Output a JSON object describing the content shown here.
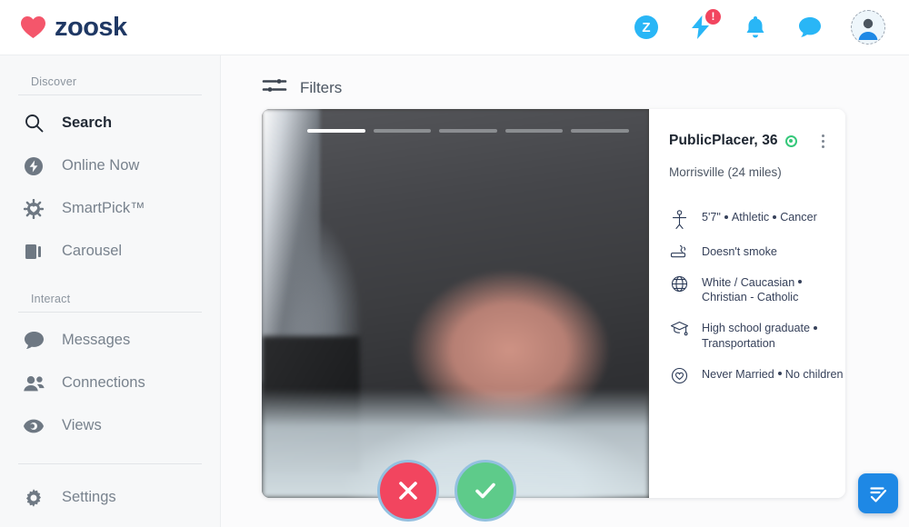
{
  "brand": {
    "name": "zoosk",
    "heart_color": "#f4566b",
    "text_color": "#1f3864"
  },
  "header": {
    "coin_label": "Z",
    "boost_badge": "!",
    "icons": [
      "zoosk-coin-icon",
      "boost-icon",
      "bell-icon",
      "chat-icon",
      "profile-avatar"
    ]
  },
  "sidebar": {
    "sections": [
      {
        "label": "Discover",
        "items": [
          {
            "label": "Search",
            "icon": "search-icon",
            "active": true
          },
          {
            "label": "Online Now",
            "icon": "online-now-icon",
            "active": false
          },
          {
            "label": "SmartPick™",
            "icon": "smartpick-icon",
            "active": false
          },
          {
            "label": "Carousel",
            "icon": "carousel-icon",
            "active": false
          }
        ]
      },
      {
        "label": "Interact",
        "items": [
          {
            "label": "Messages",
            "icon": "messages-icon",
            "active": false
          },
          {
            "label": "Connections",
            "icon": "connections-icon",
            "active": false
          },
          {
            "label": "Views",
            "icon": "views-icon",
            "active": false
          }
        ]
      }
    ],
    "settings": {
      "label": "Settings",
      "icon": "gear-icon"
    }
  },
  "main": {
    "filters_label": "Filters",
    "next_label": "›"
  },
  "profile": {
    "name_age": "PublicPlacer, 36",
    "online": true,
    "location": "Morrisville (24 miles)",
    "photo_count": 5,
    "active_photo": 1,
    "attributes": [
      {
        "icon": "body-icon",
        "parts": [
          "5'7\"",
          "Athletic",
          "Cancer"
        ]
      },
      {
        "icon": "smoking-icon",
        "parts": [
          "Doesn't smoke"
        ]
      },
      {
        "icon": "globe-icon",
        "parts": [
          "White / Caucasian",
          "Christian - Catholic"
        ]
      },
      {
        "icon": "education-icon",
        "parts": [
          "High school graduate",
          "Transportation"
        ]
      },
      {
        "icon": "heart-circle-icon",
        "parts": [
          "Never Married",
          "No children"
        ]
      }
    ]
  },
  "actions": {
    "pass_label": "✕",
    "like_label": "✓",
    "pass_color": "#f2455f",
    "like_color": "#5ecb8a"
  }
}
